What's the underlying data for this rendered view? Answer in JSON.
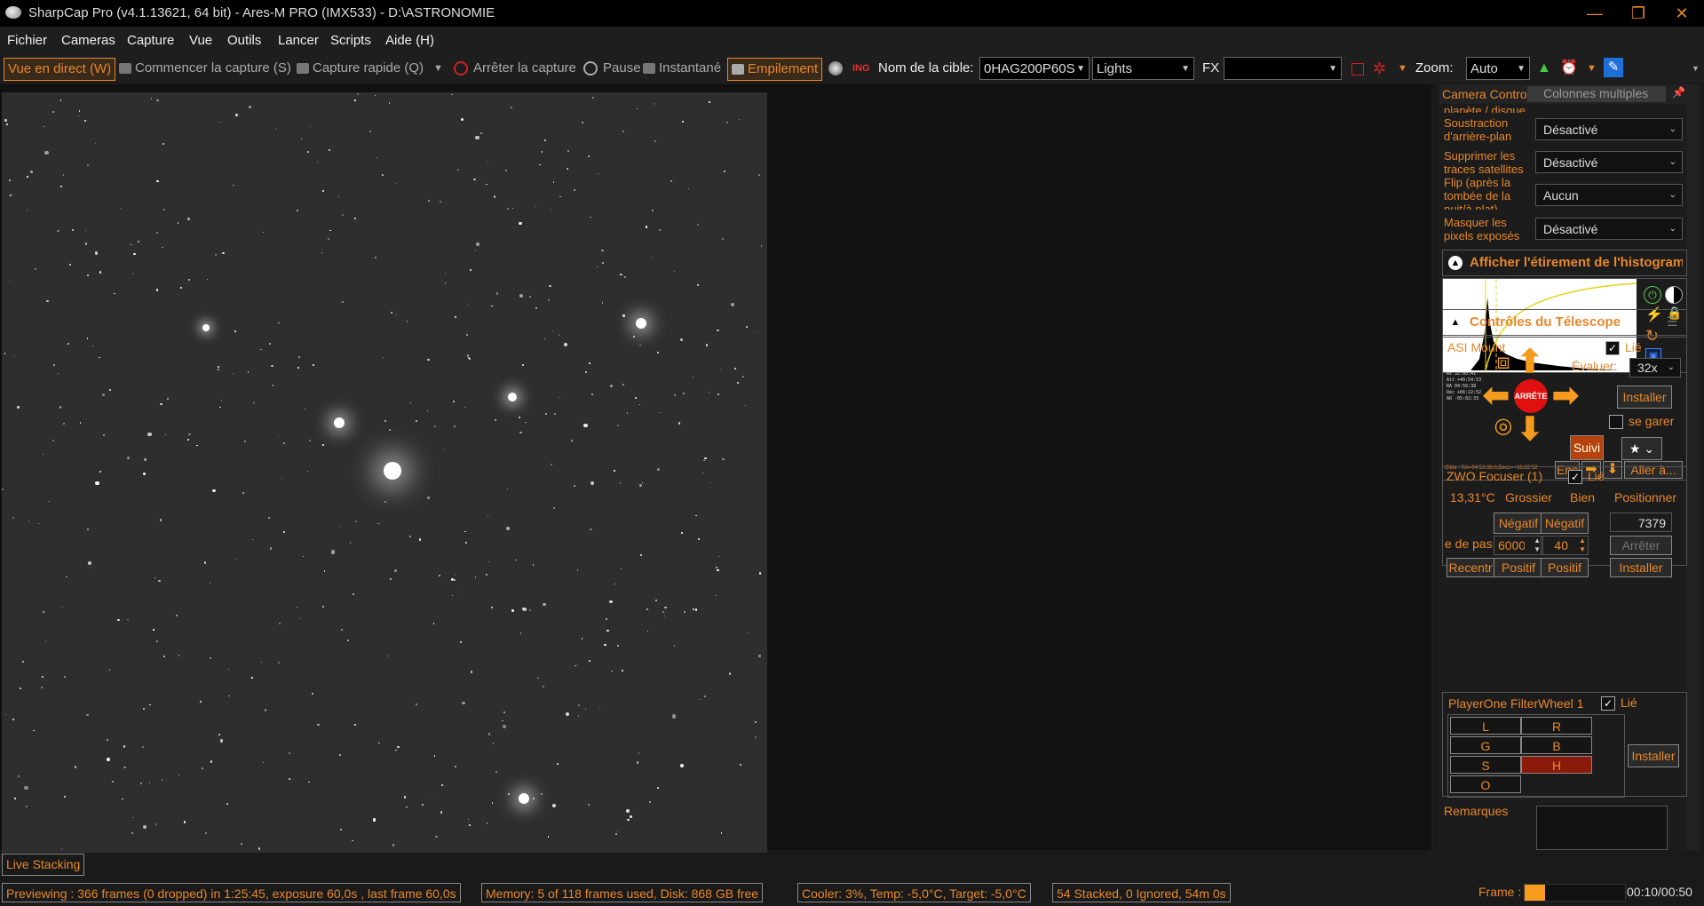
{
  "window": {
    "title": "SharpCap Pro (v4.1.13621, 64 bit) - Ares-M PRO (IMX533) - D:\\ASTRONOMIE",
    "min": "—",
    "max": "❐",
    "close": "✕"
  },
  "menu": [
    "Fichier",
    "Cameras",
    "Capture",
    "Vue",
    "Outils",
    "Lancer",
    "Scripts",
    "Aide (H)"
  ],
  "toolbar": {
    "live_view": "Vue en direct (W)",
    "start_capture": "Commencer la capture (S)",
    "quick_capture": "Capture rapide (Q)",
    "stop_capture": "Arrêter la capture",
    "pause": "Pause",
    "snapshot": "Instantané",
    "stacking": "Empilement",
    "target_label": "Nom de la cible:",
    "target_value": "0HAG200P60S",
    "frame_type": "Lights",
    "fx_label": "FX",
    "fx_value": "",
    "zoom_label": "Zoom:",
    "zoom_value": "Auto"
  },
  "panel": {
    "tab_camera": "Camera Controls",
    "tab_multi": "Colonnes multiples",
    "cut_label": "planète / disque",
    "rows": [
      {
        "label": "Soustraction d'arrière-plan",
        "value": "Désactivé"
      },
      {
        "label": "Supprimer les traces satellites",
        "value": "Désactivé"
      },
      {
        "label": "Flip (après la tombée de la nuit/à plat)",
        "value": "Aucun"
      },
      {
        "label": "Masquer les pixels exposés",
        "value": "Désactivé"
      }
    ],
    "histogram_title": "Afficher l'étirement de l'histogramme",
    "telescope_title": "Contrôles du Télescope",
    "mount": {
      "name": "ASI Mount",
      "linked": "Lié",
      "rate_label": "Évaluer:",
      "rate_value": "32x",
      "install": "Installer",
      "stop": "ARRÊTE",
      "park": "se garer",
      "tracking": "Suivi",
      "set": "Ens",
      "goto": "Aller à...",
      "coords": [
        "Az 32:00:41",
        "Alt +40:54:53",
        "RA 04:56:38",
        "Déc +66:22:52",
        "AR -05:02:33"
      ],
      "target_line": "Cible : RA=04:56:38,0,Decc=+66:22:52"
    },
    "focuser": {
      "name": "ZWO Focuser (1)",
      "linked": "Lié",
      "temp": "13,31°C",
      "coarse": "Grossier",
      "fine": "Bien",
      "position_label": "Positionner",
      "neg": "Négatif",
      "pos": "Positif",
      "position": "7379",
      "step_label": "e de pas",
      "coarse_step": "6000",
      "fine_step": "40",
      "stop": "Arrêter",
      "recenter": "Recentr",
      "install": "Installer"
    },
    "filterwheel": {
      "name": "PlayerOne FilterWheel 1",
      "linked": "Lié",
      "filters": [
        "L",
        "R",
        "G",
        "B",
        "S",
        "H",
        "O"
      ],
      "active": "H",
      "install": "Installer"
    },
    "notes_label": "Remarques"
  },
  "live_stacking_tab": "Live Stacking",
  "status": {
    "preview": "Previewing : 366 frames (0 dropped) in 1:25:45, exposure 60,0s , last frame 60,0s",
    "memory": "Memory: 5 of 118 frames used, Disk: 868 GB free",
    "cooler": "Cooler: 3%, Temp: -5,0°C, Target: -5,0°C",
    "stack": "54 Stacked, 0 Ignored, 54m 0s",
    "frame_label": "Frame :",
    "frame_time": "00:10/00:50",
    "frame_progress": 0.2
  },
  "colors": {
    "accent": "#e8872b",
    "active_filter": "#8b1a0a",
    "stop_red": "#e01010"
  }
}
